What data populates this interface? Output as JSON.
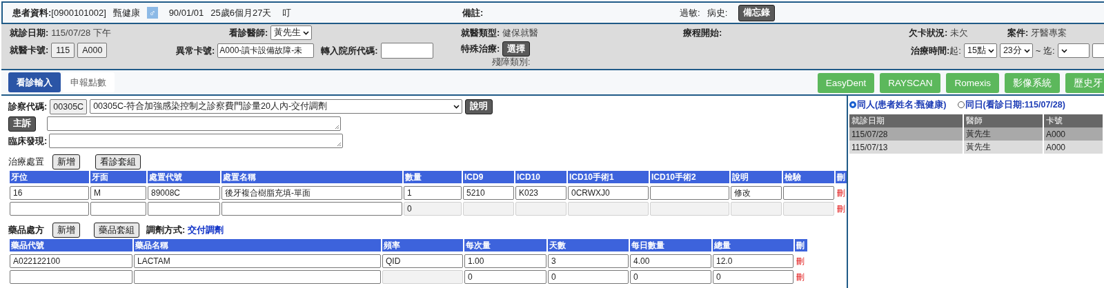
{
  "patient_bar": {
    "label": "患者資料:",
    "chart_no": "[0900101002]",
    "name": "甄健康",
    "gender": "♂",
    "birth_date": "90/01/01",
    "age": "25歲6個月27天",
    "alert": "叮",
    "remark_label": "備註:",
    "allergy_label": "過敏:",
    "history_label": "病史:",
    "memo_button": "備忘錄"
  },
  "visit_info": {
    "visit_date": {
      "label": "就診日期:",
      "value": "115/07/28 下午"
    },
    "doctor": {
      "label": "看診醫師:",
      "value": "黃先生"
    },
    "insurance_type": {
      "label": "就醫類型:",
      "value": "健保就醫"
    },
    "course_start": {
      "label": "療程開始:"
    },
    "card_debt": {
      "label": "欠卡狀況:",
      "value": "未欠"
    },
    "case": {
      "label": "案件:",
      "value": "牙醫專案"
    },
    "card_no": {
      "label": "就醫卡號:",
      "values": [
        "115",
        "A000"
      ]
    },
    "abnormal_card": {
      "label": "異常卡號:",
      "value": "A000-讀卡設備故障-未"
    },
    "transfer_code": {
      "label": "轉入院所代碼:"
    },
    "special_treatment": {
      "label": "特殊治療:",
      "button": "選擇",
      "disability_label": "殘障類別:"
    },
    "treatment_time": {
      "label": "治療時間:",
      "start_label": "起:",
      "hour": "15點",
      "minute": "23分",
      "end_label": "~ 迄:"
    }
  },
  "tabs": [
    {
      "label": "看診輸入",
      "selected": true
    },
    {
      "label": "申報點數",
      "selected": false
    }
  ],
  "external_buttons": [
    "EasyDent",
    "RAYSCAN",
    "Romexis",
    "影像系統",
    "歷史牙"
  ],
  "diagnosis": {
    "label": "診察代碼:",
    "code": "00305C",
    "selection": "00305C-符合加強感染控制之診察費門診量20人內-交付調劑",
    "explain_button": "說明",
    "complaint_button": "主訴",
    "finding_label": "臨床發現:"
  },
  "treatment": {
    "title": "治療處置",
    "buttons": [
      "新增",
      "看診套組"
    ],
    "columns": [
      "牙位",
      "牙面",
      "處置代號",
      "處置名稱",
      "數量",
      "ICD9",
      "ICD10",
      "ICD10手術1",
      "ICD10手術2",
      "說明",
      "檢驗",
      "刪"
    ],
    "rows": [
      {
        "cells": [
          {
            "value": "16",
            "disabled": false
          },
          {
            "value": "M",
            "disabled": false
          },
          {
            "value": "89008C",
            "disabled": false
          },
          {
            "value": "後牙複合樹脂充填-單面",
            "disabled": false
          },
          {
            "value": "1",
            "disabled": false
          },
          {
            "value": "5210",
            "disabled": false
          },
          {
            "value": "K023",
            "disabled": false
          },
          {
            "value": "0CRWXJ0",
            "disabled": false
          },
          {
            "disabled": false
          },
          {
            "value": "修改",
            "disabled": false
          },
          {
            "disabled": false
          }
        ],
        "delete": "刪"
      },
      {
        "cells": [
          {
            "disabled": false
          },
          {
            "disabled": false
          },
          {
            "disabled": false
          },
          {
            "disabled": false
          },
          {
            "value": "0",
            "disabled": true
          },
          {
            "disabled": true
          },
          {
            "disabled": true
          },
          {
            "disabled": true
          },
          {
            "disabled": true
          },
          {
            "disabled": true
          },
          {
            "disabled": true
          }
        ],
        "delete": "刪"
      }
    ]
  },
  "medication": {
    "title": "藥品處方",
    "buttons": [
      "新增",
      "藥品套組"
    ],
    "dispense_label": "調劑方式:",
    "dispense_value": "交付調劑",
    "columns": [
      "藥品代號",
      "藥品名稱",
      "頻率",
      "每次量",
      "天數",
      "每日數量",
      "總量",
      "刪"
    ],
    "rows": [
      {
        "cells": [
          {
            "value": "A022122100",
            "disabled": false
          },
          {
            "value": "LACTAM",
            "disabled": false
          },
          {
            "value": "QID",
            "disabled": false
          },
          {
            "value": "1.00",
            "disabled": false
          },
          {
            "value": "3",
            "disabled": false
          },
          {
            "value": "4.00",
            "disabled": false
          },
          {
            "value": "12.0",
            "disabled": false
          }
        ],
        "delete": "刪"
      },
      {
        "cells": [
          {
            "disabled": false
          },
          {
            "disabled": false
          },
          {
            "disabled": true
          },
          {
            "value": "0",
            "disabled": false
          },
          {
            "value": "0",
            "disabled": false
          },
          {
            "value": "0",
            "disabled": false
          },
          {
            "value": "0",
            "disabled": false
          }
        ],
        "delete": "刪"
      }
    ]
  },
  "history": {
    "options": [
      {
        "label": "同人(患者姓名:甄健康)",
        "selected": true
      },
      {
        "label": "同日(看診日期:115/07/28)",
        "selected": false
      }
    ],
    "columns": [
      "就診日期",
      "醫師",
      "卡號"
    ],
    "rows": [
      {
        "cells": [
          "115/07/28",
          "黃先生",
          "A000"
        ],
        "selected": true
      },
      {
        "cells": [
          "115/07/13",
          "黃先生",
          "A000"
        ],
        "selected": false
      }
    ]
  }
}
